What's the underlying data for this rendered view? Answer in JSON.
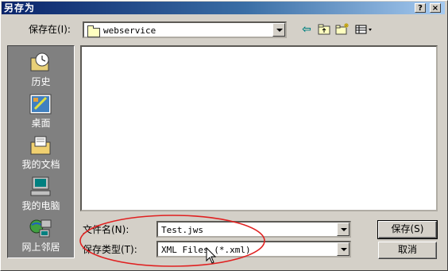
{
  "window": {
    "title": "另存为"
  },
  "title_buttons": {
    "help": "?",
    "close": "×"
  },
  "save_in": {
    "label": "保存在(I):",
    "value": "webservice"
  },
  "places": [
    {
      "label": "历史",
      "icon": "history-icon"
    },
    {
      "label": "桌面",
      "icon": "desktop-icon"
    },
    {
      "label": "我的文档",
      "icon": "my-documents-icon"
    },
    {
      "label": "我的电脑",
      "icon": "my-computer-icon"
    },
    {
      "label": "网上邻居",
      "icon": "network-places-icon"
    }
  ],
  "filename": {
    "label": "文件名(N):",
    "value": "Test.jws"
  },
  "filetype": {
    "label": "保存类型(T):",
    "value": "XML Files (*.xml)"
  },
  "buttons": {
    "save": "保存(S)",
    "cancel": "取消"
  },
  "colors": {
    "titlebar": "#0a246a",
    "annotation": "#e02020",
    "face": "#d4d0c8"
  }
}
